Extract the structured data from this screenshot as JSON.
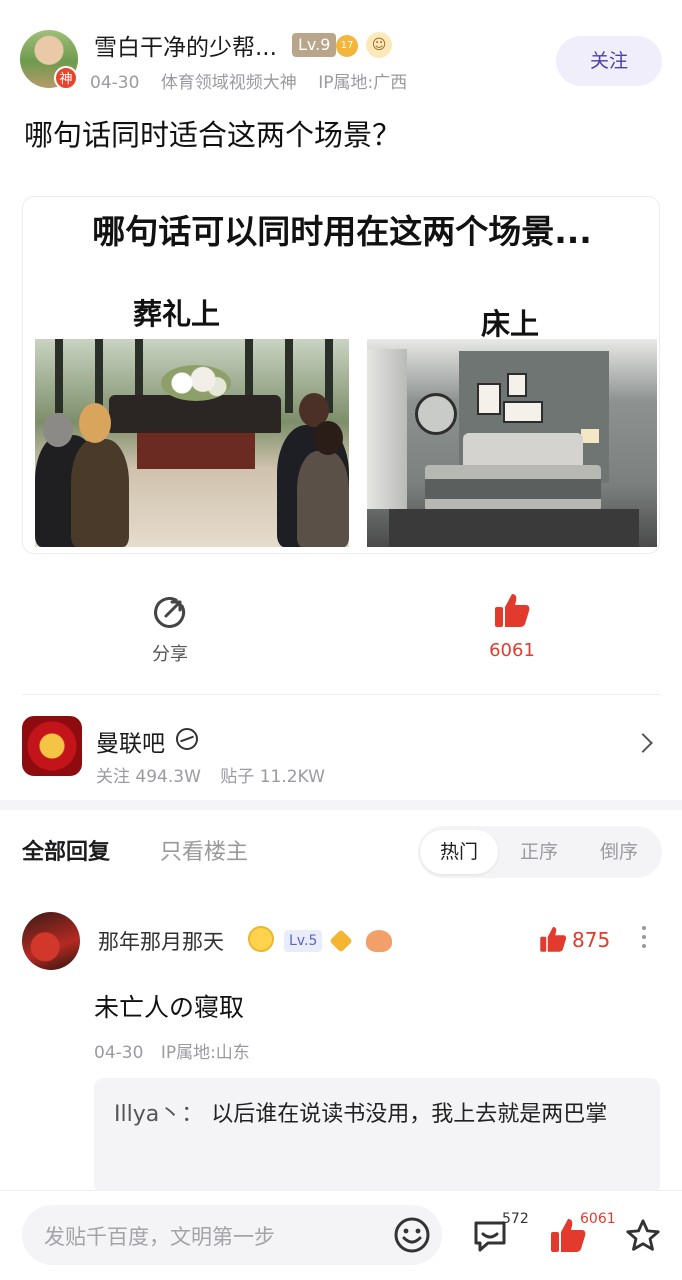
{
  "post": {
    "author_name": "雪白干净的少帮...",
    "author_level": "Lv.9",
    "coin_badge": "17",
    "avatar_badge": "神",
    "date": "04-30",
    "title_badge": "体育领域视频大神",
    "ip": "IP属地:广西",
    "follow_label": "关注",
    "title": "哪句话同时适合这两个场景？"
  },
  "meme": {
    "heading": "哪句话可以同时用在这两个场景...",
    "left_label": "葬礼上",
    "right_label": "床上"
  },
  "actions": {
    "share_label": "分享",
    "like_count": "6061"
  },
  "forum": {
    "name": "曼联吧",
    "followers": "关注 494.3W",
    "posts": "贴子 11.2KW"
  },
  "reply_tabs": {
    "all": "全部回复",
    "op_only": "只看楼主",
    "sort": [
      "热门",
      "正序",
      "倒序"
    ]
  },
  "comment": {
    "author": "那年那月那天",
    "level": "Lv.5",
    "likes": "875",
    "text": "未亡人の寝取",
    "date": "04-30",
    "ip": "IP属地:山东",
    "reply_author": "Illya丶：",
    "reply_text": "以后谁在说读书没用，我上去就是两巴掌"
  },
  "bottom_bar": {
    "placeholder": "发贴千百度，文明第一步",
    "comment_count": "572",
    "like_count": "6061"
  },
  "colors": {
    "accent": "#4b3fa8",
    "like_red": "#e23b2d"
  },
  "icons": [
    "share-icon",
    "thumbs-up-icon",
    "chevron-right-icon",
    "more-icon",
    "emoji-icon",
    "comment-icon",
    "star-icon"
  ]
}
